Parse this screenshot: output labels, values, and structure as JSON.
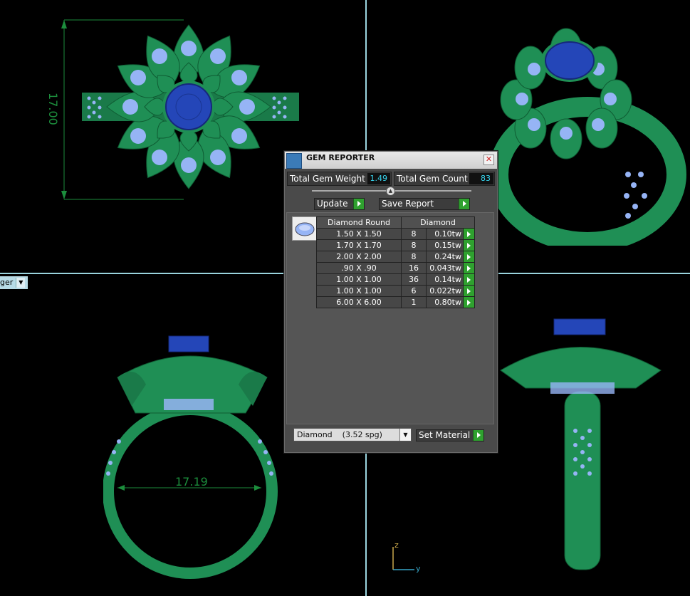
{
  "viewport": {
    "view_label": "ger",
    "dimension_top": "17.00",
    "dimension_bottom": "17.19",
    "axis": {
      "z": "z",
      "y": "y"
    },
    "colors": {
      "metal": "#1f8f55",
      "accent_stone": "#2446b8",
      "diamond": "#96b4f5",
      "divider": "#9ad4de"
    }
  },
  "gem_reporter": {
    "title": "GEM REPORTER",
    "total_weight_label": "Total Gem Weight",
    "total_weight_value": "1.49",
    "total_count_label": "Total Gem Count",
    "total_count_value": "83",
    "update_label": "Update",
    "save_report_label": "Save Report",
    "table": {
      "headers": [
        "Diamond Round",
        "Diamond"
      ],
      "rows": [
        {
          "size": "1.50 X 1.50",
          "count": "8",
          "weight": "0.10tw"
        },
        {
          "size": "1.70 X 1.70",
          "count": "8",
          "weight": "0.15tw"
        },
        {
          "size": "2.00 X 2.00",
          "count": "8",
          "weight": "0.24tw"
        },
        {
          "size": ".90 X .90",
          "count": "16",
          "weight": "0.043tw"
        },
        {
          "size": "1.00 X 1.00",
          "count": "36",
          "weight": "0.14tw"
        },
        {
          "size": "1.00 X 1.00",
          "count": "6",
          "weight": "0.022tw"
        },
        {
          "size": "6.00 X 6.00",
          "count": "1",
          "weight": "0.80tw"
        }
      ]
    },
    "material_select": "Diamond    (3.52 spg)",
    "set_material_label": "Set Material"
  }
}
